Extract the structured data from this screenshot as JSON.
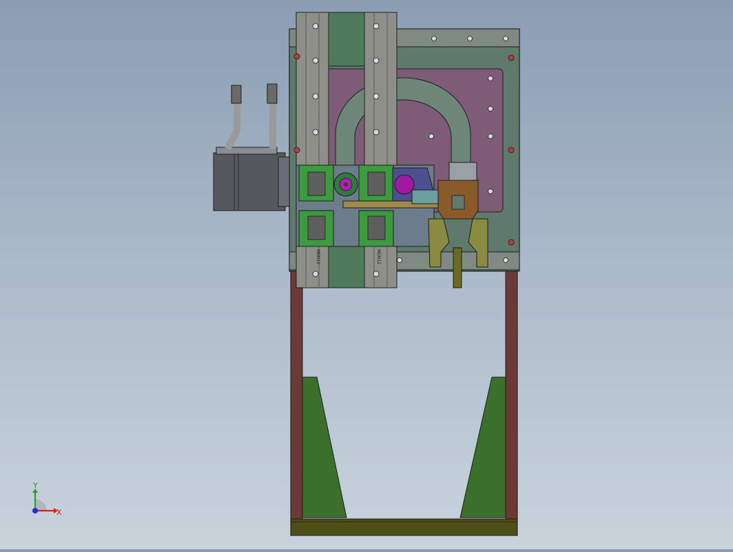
{
  "viewport": {
    "background_top": "#8a9db3",
    "background_bottom": "#c9d3dc"
  },
  "model": {
    "colors": {
      "base_plate": "#5f7a6c",
      "inner_plate": "#7e5c78",
      "rail": "#8f8f8a",
      "bearing_block": "#3c9a3f",
      "motor": "#55595e",
      "frame_post": "#6b3a36",
      "green_wedge": "#3a6f2c",
      "base_bar": "#4e4e18",
      "bracket": "#8a5a2a",
      "cable": "#9a9a9a",
      "hole": "#b83a3a"
    },
    "rail_labels": [
      "MGN12",
      "MGN12"
    ]
  },
  "triad": {
    "x_label": "X",
    "y_label": "Y",
    "x_color": "#d42020",
    "y_color": "#22a022",
    "z_color": "#2030c8"
  }
}
